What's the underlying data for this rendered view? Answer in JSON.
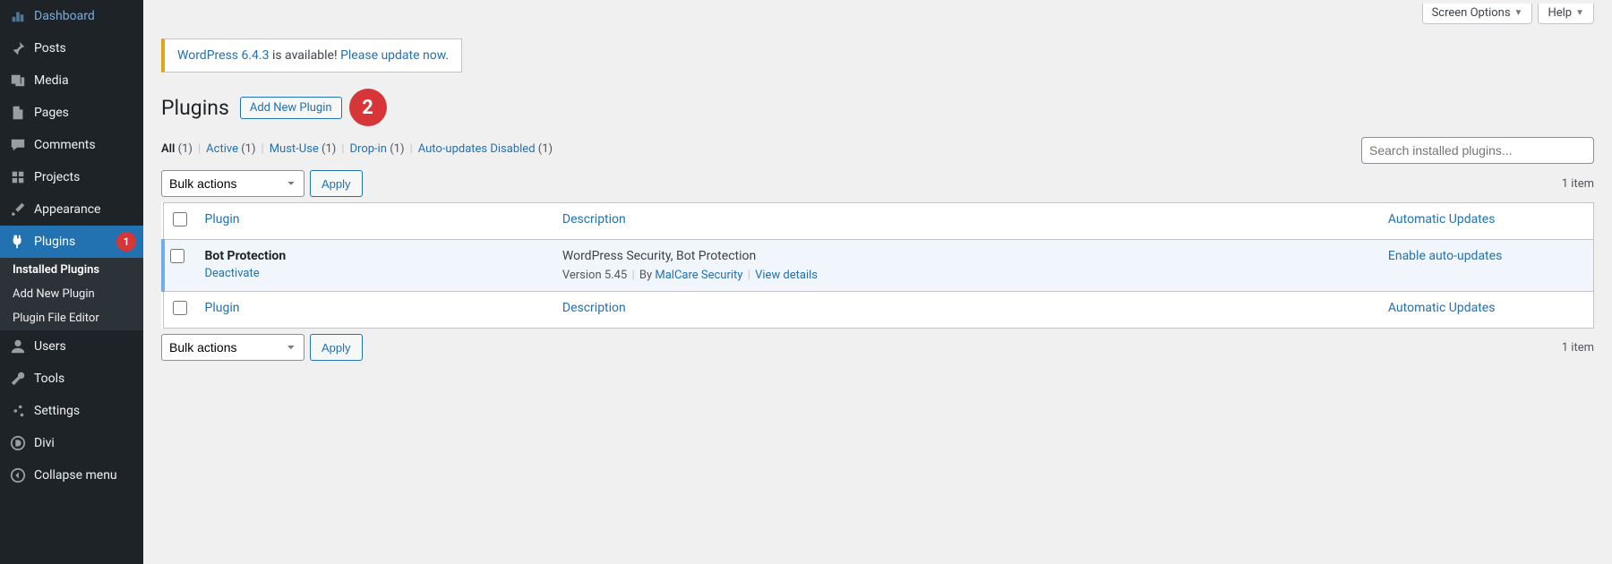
{
  "sidebar": {
    "dashboard": "Dashboard",
    "posts": "Posts",
    "media": "Media",
    "pages": "Pages",
    "comments": "Comments",
    "projects": "Projects",
    "appearance": "Appearance",
    "plugins": "Plugins",
    "plugins_badge": "1",
    "submenu": {
      "installed": "Installed Plugins",
      "add_new": "Add New Plugin",
      "editor": "Plugin File Editor"
    },
    "users": "Users",
    "tools": "Tools",
    "settings": "Settings",
    "divi": "Divi",
    "collapse": "Collapse menu"
  },
  "top": {
    "screen_options": "Screen Options",
    "help": "Help"
  },
  "nag": {
    "link": "WordPress 6.4.3",
    "middle": " is available! ",
    "update_link": "Please update now",
    "tail": "."
  },
  "heading": "Plugins",
  "add_new_btn": "Add New Plugin",
  "annotation_bubble": "2",
  "filters": {
    "all": "All",
    "all_count": "(1)",
    "active": "Active",
    "active_count": "(1)",
    "mustuse": "Must-Use",
    "mustuse_count": "(1)",
    "dropin": "Drop-in",
    "dropin_count": "(1)",
    "autodis": "Auto-updates Disabled",
    "autodis_count": "(1)"
  },
  "search_placeholder": "Search installed plugins...",
  "bulk_default": "Bulk actions",
  "apply": "Apply",
  "item_count": "1 item",
  "columns": {
    "plugin": "Plugin",
    "description": "Description",
    "auto": "Automatic Updates"
  },
  "plugin": {
    "name": "Bot Protection",
    "deactivate": "Deactivate",
    "description": "WordPress Security, Bot Protection",
    "version_label": "Version 5.45",
    "by": "By",
    "author": "MalCare Security",
    "view_details": "View details",
    "enable_auto": "Enable auto-updates"
  }
}
